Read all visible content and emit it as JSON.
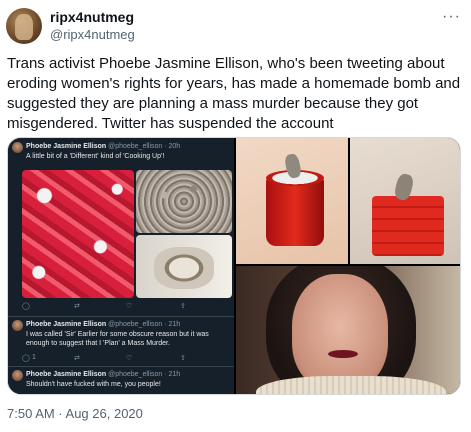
{
  "user": {
    "display_name": "ripx4nutmeg",
    "handle": "@ripx4nutmeg"
  },
  "menu": {
    "more_icon": "more-horizontal-icon",
    "more_glyph": "···"
  },
  "tweet": {
    "text": "Trans activist Phoebe Jasmine Ellison, who's been tweeting about eroding women's rights for years, has made a homemade bomb and suggested they are planning a mass murder because they got misgendered. Twitter has suspended the account",
    "timestamp": "7:50 AM · Aug 26, 2020"
  },
  "embedded_tweets": [
    {
      "name": "Phoebe Jasmine Ellison",
      "meta": "@phoebe_ellison · 20h",
      "body": "A little bit of a 'Different' kind of 'Cooking Up'!"
    },
    {
      "name": "Phoebe Jasmine Ellison",
      "meta": "@phoebe_ellison · 21h",
      "body": "I was called 'Sir' Earlier for some obscure reason but it was enough to suggest that I 'Plan' a Mass Murder.",
      "actions": {
        "reply": "",
        "retweet": "",
        "like": "1",
        "share": ""
      }
    },
    {
      "name": "Phoebe Jasmine Ellison",
      "meta": "@phoebe_ellison · 21h",
      "body": "Shouldn't have fucked with me, you people!"
    }
  ],
  "colors": {
    "text_primary": "#0f1419",
    "text_secondary": "#536471",
    "dark_bg": "#15202b"
  }
}
